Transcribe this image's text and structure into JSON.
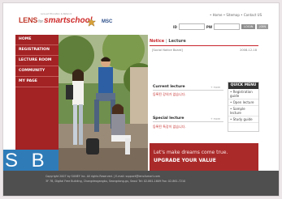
{
  "header": {
    "logo_lens": "LENS",
    "logo_for": "for",
    "logo_smart": "smartschool",
    "logo_sub": "Lens-ed Education & Network",
    "partner": "MSC",
    "top_links": "• Home  • Sitemap  • Contact US",
    "login": {
      "id_label": "ID",
      "pw_label": "PW",
      "login_btn": "LOGIN",
      "join_btn": "JOIN"
    }
  },
  "nav": {
    "items": [
      "HOME",
      "REGISTRATION",
      "LECTURE ROOM",
      "COMMUNITY",
      "MY PAGE"
    ]
  },
  "overlay_badge": "S B",
  "content": {
    "tab_notice": "Notice",
    "tab_sep": " | ",
    "tab_lecture": "Lecture",
    "notice_row": {
      "title": "[Social Notice Board]",
      "date": "2008-12-18"
    },
    "current": {
      "title": "Current lecture",
      "more": "+ more",
      "empty": "등록된 강의가 없습니다."
    },
    "special": {
      "title": "Special lecture",
      "more": "+ more",
      "empty": "등록된 특강이 없습니다."
    }
  },
  "quick_menu": {
    "title": "QUICK MENU",
    "items": [
      "• Registration guide",
      "• Open lecture",
      "• Sample lecture",
      "• Study guide"
    ]
  },
  "banner": {
    "line1": "Let's make dreams come true.",
    "line2": "UPGRADE YOUR VALUE"
  },
  "footer": {
    "line1": "Copyright 2007 by SUNEY Inc. All rights Reserved. | E-mail: support@lens4smart.com",
    "line2": "3F 7B, Digital Free Building, Changdeogangbu, Seongdong-gu, Seoul Tel: 02-861-1609  Fax: 02-861-7210"
  }
}
